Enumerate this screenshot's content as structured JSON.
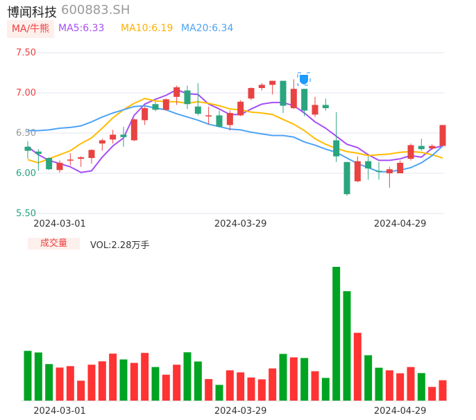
{
  "header": {
    "name": "博闻科技",
    "code": "600883.SH"
  },
  "ma_legend": {
    "badge": "MA/牛熊",
    "ma5": "MA5:6.33",
    "ma10": "MA10:6.19",
    "ma20": "MA20:6.34"
  },
  "volume_legend": {
    "badge": "成交量",
    "vol": "VOL:2.28万手"
  },
  "colors": {
    "up": "#e84242",
    "down": "#2aa57f",
    "vol_up": "#ff3333",
    "vol_down": "#00a422",
    "ma5": "#a64df5",
    "ma10": "#ffbb00",
    "ma20": "#4da3f5"
  },
  "chart_data": [
    {
      "type": "candlestick",
      "title": "博闻科技 600883.SH",
      "ylim": [
        5.5,
        7.5
      ],
      "yticks": [
        "7.50",
        "7.00",
        "6.50",
        "6.00",
        "5.50"
      ],
      "xtick_labels": [
        {
          "index": 3,
          "label": "2024-03-01"
        },
        {
          "index": 20,
          "label": "2024-03-29"
        },
        {
          "index": 35,
          "label": "2024-04-29"
        }
      ],
      "ohlc": [
        [
          6.33,
          6.4,
          6.18,
          6.28
        ],
        [
          6.27,
          6.3,
          6.03,
          6.24
        ],
        [
          6.19,
          6.2,
          6.04,
          6.05
        ],
        [
          6.04,
          6.16,
          6.01,
          6.13
        ],
        [
          6.16,
          6.25,
          6.1,
          6.17
        ],
        [
          6.18,
          6.21,
          6.08,
          6.2
        ],
        [
          6.19,
          6.3,
          6.12,
          6.29
        ],
        [
          6.37,
          6.43,
          6.28,
          6.41
        ],
        [
          6.42,
          6.54,
          6.37,
          6.48
        ],
        [
          6.48,
          6.58,
          6.33,
          6.45
        ],
        [
          6.41,
          6.68,
          6.4,
          6.67
        ],
        [
          6.66,
          6.83,
          6.6,
          6.81
        ],
        [
          6.86,
          6.89,
          6.77,
          6.79
        ],
        [
          6.79,
          6.93,
          6.78,
          6.92
        ],
        [
          6.95,
          7.09,
          6.85,
          7.07
        ],
        [
          7.03,
          7.09,
          6.8,
          6.86
        ],
        [
          6.83,
          7.12,
          6.72,
          6.74
        ],
        [
          6.72,
          6.83,
          6.61,
          6.72
        ],
        [
          6.72,
          6.78,
          6.57,
          6.58
        ],
        [
          6.6,
          6.78,
          6.53,
          6.75
        ],
        [
          6.72,
          6.91,
          6.71,
          6.89
        ],
        [
          6.93,
          7.07,
          6.91,
          7.06
        ],
        [
          7.06,
          7.12,
          7.03,
          7.1
        ],
        [
          7.1,
          7.15,
          6.98,
          7.15
        ],
        [
          7.15,
          7.15,
          6.75,
          6.84
        ],
        [
          6.81,
          7.17,
          6.8,
          7.05
        ],
        [
          7.05,
          7.05,
          6.71,
          6.78
        ],
        [
          6.73,
          6.95,
          6.7,
          6.85
        ],
        [
          6.85,
          6.93,
          6.78,
          6.81
        ],
        [
          6.41,
          6.76,
          6.14,
          6.21
        ],
        [
          6.14,
          6.14,
          5.72,
          5.74
        ],
        [
          5.9,
          6.21,
          5.89,
          6.15
        ],
        [
          6.15,
          6.21,
          5.92,
          6.06
        ],
        [
          6.03,
          6.14,
          5.92,
          6.02
        ],
        [
          6.0,
          6.08,
          5.82,
          6.05
        ],
        [
          6.0,
          6.16,
          6.0,
          6.13
        ],
        [
          6.18,
          6.37,
          6.16,
          6.35
        ],
        [
          6.34,
          6.43,
          6.28,
          6.3
        ],
        [
          6.31,
          6.36,
          6.29,
          6.34
        ],
        [
          6.34,
          6.6,
          6.34,
          6.6
        ]
      ],
      "series": [
        {
          "name": "MA5",
          "values": [
            6.33,
            6.23,
            6.16,
            6.12,
            6.08,
            6.01,
            6.03,
            6.2,
            6.34,
            6.44,
            6.72,
            6.86,
            6.92,
            6.97,
            7.04,
            6.99,
            6.98,
            6.86,
            6.8,
            6.73,
            6.73,
            6.8,
            6.86,
            6.88,
            6.88,
            6.84,
            6.75,
            6.64,
            6.56,
            6.46,
            6.36,
            6.32,
            6.23,
            6.16,
            6.16,
            6.18,
            6.22,
            6.2,
            6.31,
            6.34
          ]
        },
        {
          "name": "MA10",
          "values": [
            6.17,
            6.13,
            6.18,
            6.23,
            6.28,
            6.37,
            6.44,
            6.56,
            6.69,
            6.79,
            6.87,
            6.93,
            6.9,
            6.89,
            6.89,
            6.87,
            6.89,
            6.87,
            6.84,
            6.8,
            6.79,
            6.76,
            6.75,
            6.73,
            6.67,
            6.61,
            6.53,
            6.43,
            6.36,
            6.31,
            6.27,
            6.25,
            6.22,
            6.23,
            6.24,
            6.26,
            6.27,
            6.26,
            6.23,
            6.19
          ]
        },
        {
          "name": "MA20",
          "values": [
            6.53,
            6.53,
            6.54,
            6.56,
            6.57,
            6.59,
            6.64,
            6.7,
            6.75,
            6.79,
            6.83,
            6.84,
            6.81,
            6.79,
            6.74,
            6.7,
            6.66,
            6.61,
            6.58,
            6.55,
            6.54,
            6.51,
            6.49,
            6.47,
            6.47,
            6.45,
            6.39,
            6.35,
            6.3,
            6.26,
            6.19,
            6.12,
            6.07,
            6.02,
            6.02,
            6.04,
            6.07,
            6.13,
            6.22,
            6.34
          ]
        }
      ]
    },
    {
      "type": "bar",
      "title": "成交量",
      "unit": "万手",
      "ylim": [
        0,
        15
      ],
      "values": [
        5.57,
        5.39,
        4.09,
        3.7,
        3.86,
        2.23,
        4.02,
        4.4,
        5.26,
        4.61,
        4.22,
        5.34,
        3.76,
        2.9,
        4.02,
        5.41,
        4.38,
        2.41,
        1.76,
        3.39,
        3.16,
        2.59,
        2.38,
        3.6,
        5.23,
        4.84,
        4.77,
        3.29,
        2.54,
        14.98,
        12.25,
        7.59,
        5.08,
        3.68,
        3.39,
        3.06,
        3.76,
        3.08,
        1.53,
        2.28
      ],
      "xtick_labels": [
        {
          "index": 3,
          "label": "2024-03-01"
        },
        {
          "index": 20,
          "label": "2024-03-29"
        },
        {
          "index": 35,
          "label": "2024-04-29"
        }
      ]
    }
  ]
}
